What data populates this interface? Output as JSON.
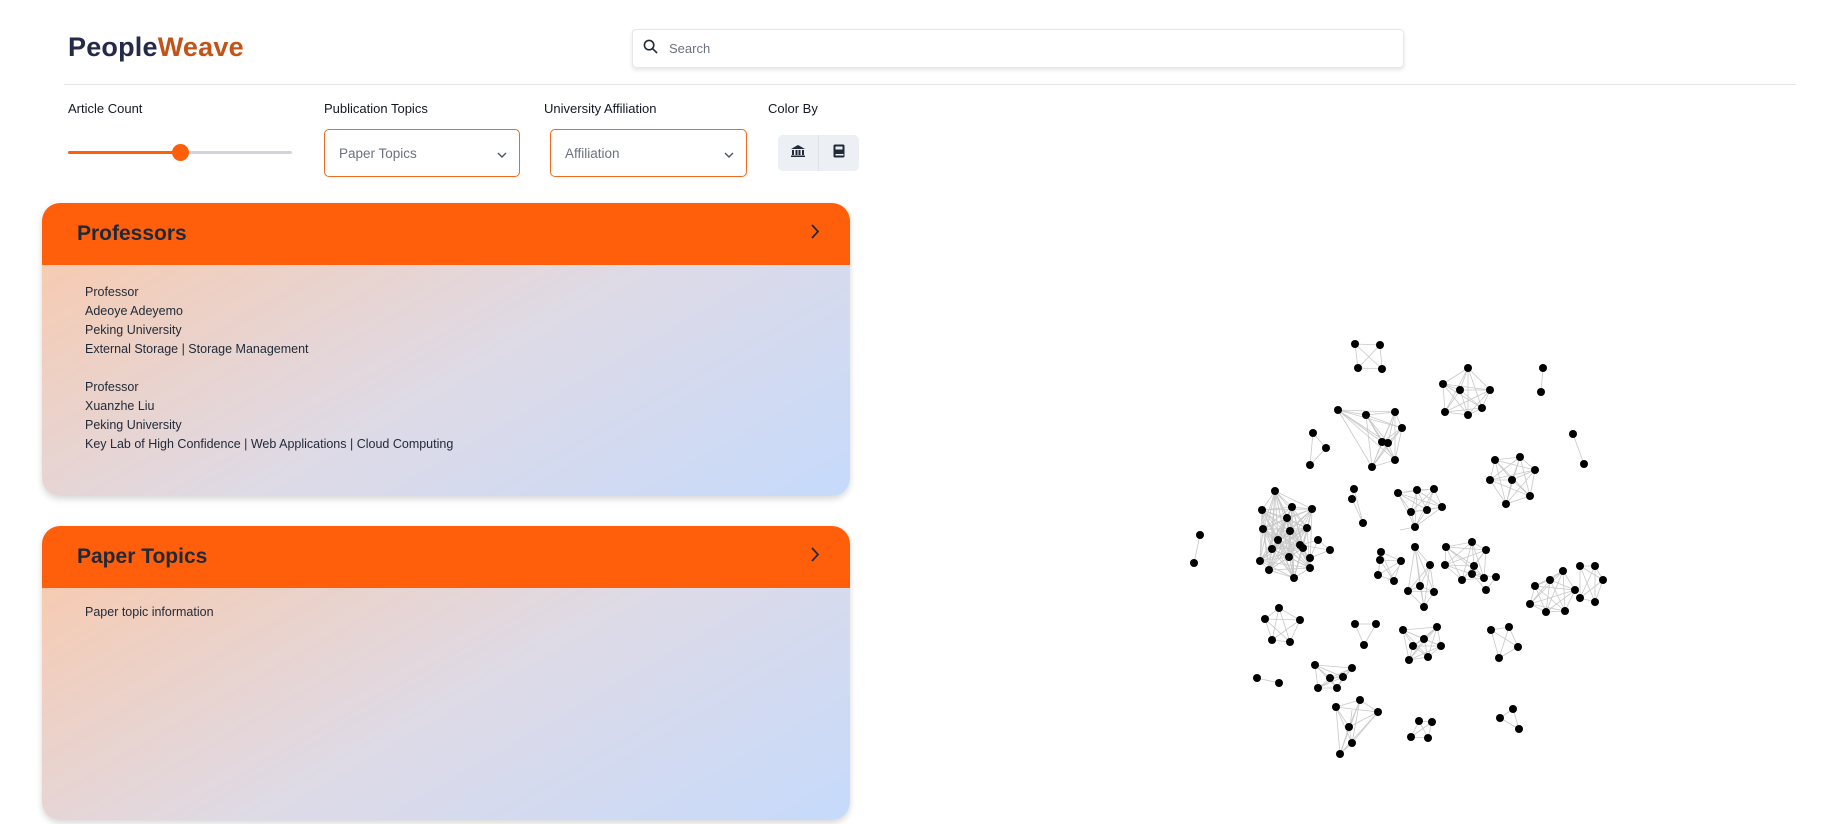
{
  "header": {
    "logo_part1": "People",
    "logo_part2": "Weave",
    "search_placeholder": "Search"
  },
  "controls": {
    "article_count": {
      "label": "Article Count",
      "value_fraction": 0.5
    },
    "publication_topics": {
      "label": "Publication Topics",
      "placeholder": "Paper Topics"
    },
    "university_affiliation": {
      "label": "University Affiliation",
      "placeholder": "Affiliation"
    },
    "color_by": {
      "label": "Color By",
      "options": [
        {
          "icon": "university-icon"
        },
        {
          "icon": "book-icon"
        }
      ]
    }
  },
  "professors_card": {
    "title": "Professors",
    "entries": [
      {
        "role": "Professor",
        "name": "Adeoye Adeyemo",
        "university": "Peking University",
        "topics": "External Storage | Storage Management"
      },
      {
        "role": "Professor",
        "name": "Xuanzhe Liu",
        "university": "Peking University",
        "topics": "Key Lab of High Confidence | Web Applications | Cloud Computing"
      }
    ]
  },
  "paper_topics_card": {
    "title": "Paper Topics",
    "info": "Paper topic information"
  },
  "colors": {
    "accent": "#ff5f0a",
    "logo_dark": "#252a4a",
    "logo_accent": "#c2541a",
    "node": "#000000",
    "edge": "#c8c8c8"
  }
}
